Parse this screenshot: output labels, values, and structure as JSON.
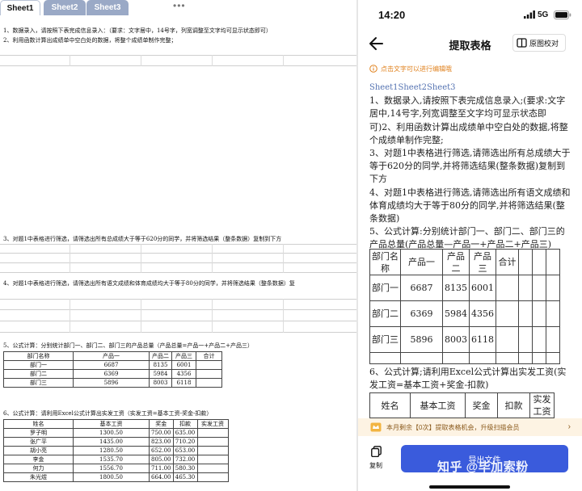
{
  "sheet": {
    "tabs": [
      "Sheet1",
      "Sheet2",
      "Sheet3"
    ],
    "more": "•••",
    "line1": "1、数据录入，请按照下表完成信息录入：（要求：文字居中，14号字，列宽调整至文字均可显示状态即可）",
    "line2": "2、利用函数计算出成绩单中空白处的数据，将整个成绩单制作完整；",
    "line3": "3、对题1中表格进行筛选，请筛选出所有总成绩大于等于620分的同学，并将筛选结果（整条数据）复制到下方",
    "line4": "4、对题1中表格进行筛选，请筛选出所有语文成绩和体育成绩均大于等于80分的同学，并将筛选结果（整条数据）复",
    "line5": "5、公式计算：分别统计部门一、部门二、部门三的产品总量（产品总量=产品一+产品二+产品三）",
    "line6": "6、公式计算：请利用Excel公式计算出实发工资（实发工资=基本工资-奖金-扣款）",
    "dept_table": {
      "headers": [
        "部门名称",
        "产品一",
        "产品二",
        "产品三",
        "合计"
      ],
      "rows": [
        [
          "部门一",
          "6687",
          "8135",
          "6001",
          ""
        ],
        [
          "部门二",
          "6369",
          "5984",
          "4356",
          ""
        ],
        [
          "部门三",
          "5896",
          "8003",
          "6118",
          ""
        ]
      ]
    },
    "pay_table": {
      "headers": [
        "姓名",
        "基本工资",
        "奖金",
        "扣款",
        "实发工资"
      ],
      "rows": [
        [
          "罗子明",
          "1300.50",
          "750.00",
          "635.00",
          ""
        ],
        [
          "张广平",
          "1435.00",
          "823.00",
          "710.20",
          ""
        ],
        [
          "胡小亮",
          "1280.50",
          "652.00",
          "653.00",
          ""
        ],
        [
          "李金",
          "1535.70",
          "805.00",
          "732.00",
          ""
        ],
        [
          "何力",
          "1556.70",
          "711.00",
          "580.30",
          ""
        ],
        [
          "朱光煜",
          "1800.50",
          "664.00",
          "465.30",
          ""
        ]
      ]
    }
  },
  "phone": {
    "status": {
      "time": "14:20",
      "network": "5G"
    },
    "nav": {
      "title": "提取表格",
      "compare": "原图校对"
    },
    "hint": "点击文字可以进行编辑哦",
    "doc": {
      "sheets": "Sheet1Sheet2Sheet3",
      "p1": "1、数据录入,请按照下表完成信息录入;(要求:文字居中,14号字,列宽调整至文字均可显示状态即可)2、利用函数计算出成绩单中空白处的数据,将整个成绩单制作完整;",
      "p2": "3、对题1中表格进行筛选,请筛选出所有总成绩大于等于620分的同学,并将筛选结果(整条数据)复制到下方",
      "p3": "4、对题1中表格进行筛选,请筛选出所有语文成绩和体育成绩均大于等于80分的同学,并将筛选结果(整条数据)",
      "p4": "5、公式计算:分别统计部门一、部门二、部门三的产品总量(产品总量—产品一+产品二+产品三)",
      "p5": "6、公式计算;请利用Excel公式计算出实发工资(实发工资=基本工资+奖金-扣款)"
    },
    "dept_table": {
      "headers": [
        "部门名称",
        "产品一",
        "产品二",
        "产品三",
        "合计"
      ],
      "rows": [
        [
          "部门一",
          "6687",
          "8135",
          "6001",
          ""
        ],
        [
          "部门二",
          "6369",
          "5984",
          "4356",
          ""
        ],
        [
          "部门三",
          "5896",
          "8003",
          "6118",
          ""
        ]
      ]
    },
    "pay_headers": [
      "姓名",
      "基本工资",
      "奖金",
      "扣款",
      "实发工资"
    ],
    "promo": "本月剩余【0次】提取表格机会，升级扫描会员",
    "copy_label": "复制",
    "export_label": "导出文件",
    "watermark": "知乎 @毕加索粉"
  },
  "colors": {
    "accent": "#3a5bdc",
    "hint": "#e0821e",
    "tab": "#9aa9c6"
  }
}
